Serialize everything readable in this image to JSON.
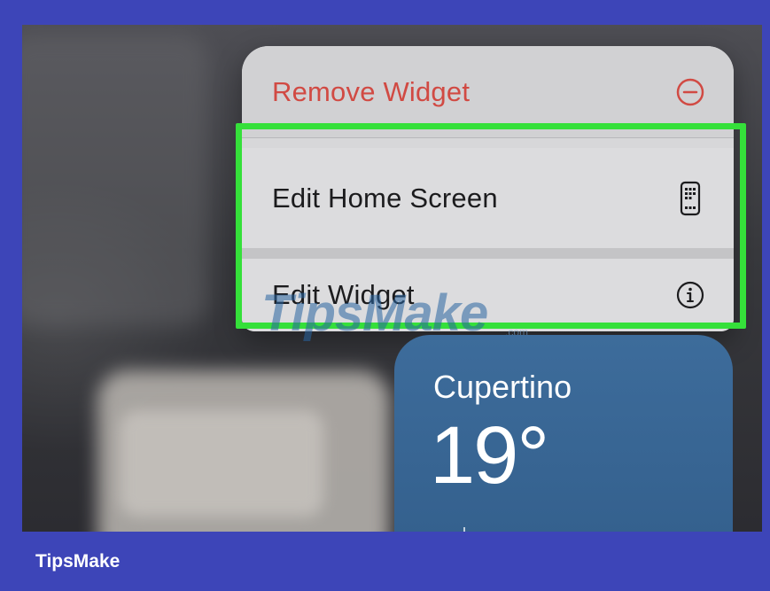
{
  "menu": {
    "remove_label": "Remove Widget",
    "remove_icon": "minus-circle-icon",
    "edit_home_label": "Edit Home Screen",
    "edit_home_icon": "phone-screen-icon",
    "edit_widget_label": "Edit Widget",
    "edit_widget_icon": "info-icon"
  },
  "weather": {
    "city": "Cupertino",
    "temperature": "19°"
  },
  "watermark": {
    "text": "TipsMake",
    "suffix": ".com"
  },
  "footer": {
    "brand": "TipsMake"
  },
  "colors": {
    "frame": "#3d45b8",
    "highlight": "#35e03a",
    "destructive": "#d14a43",
    "weather": "#3d6c9b"
  }
}
